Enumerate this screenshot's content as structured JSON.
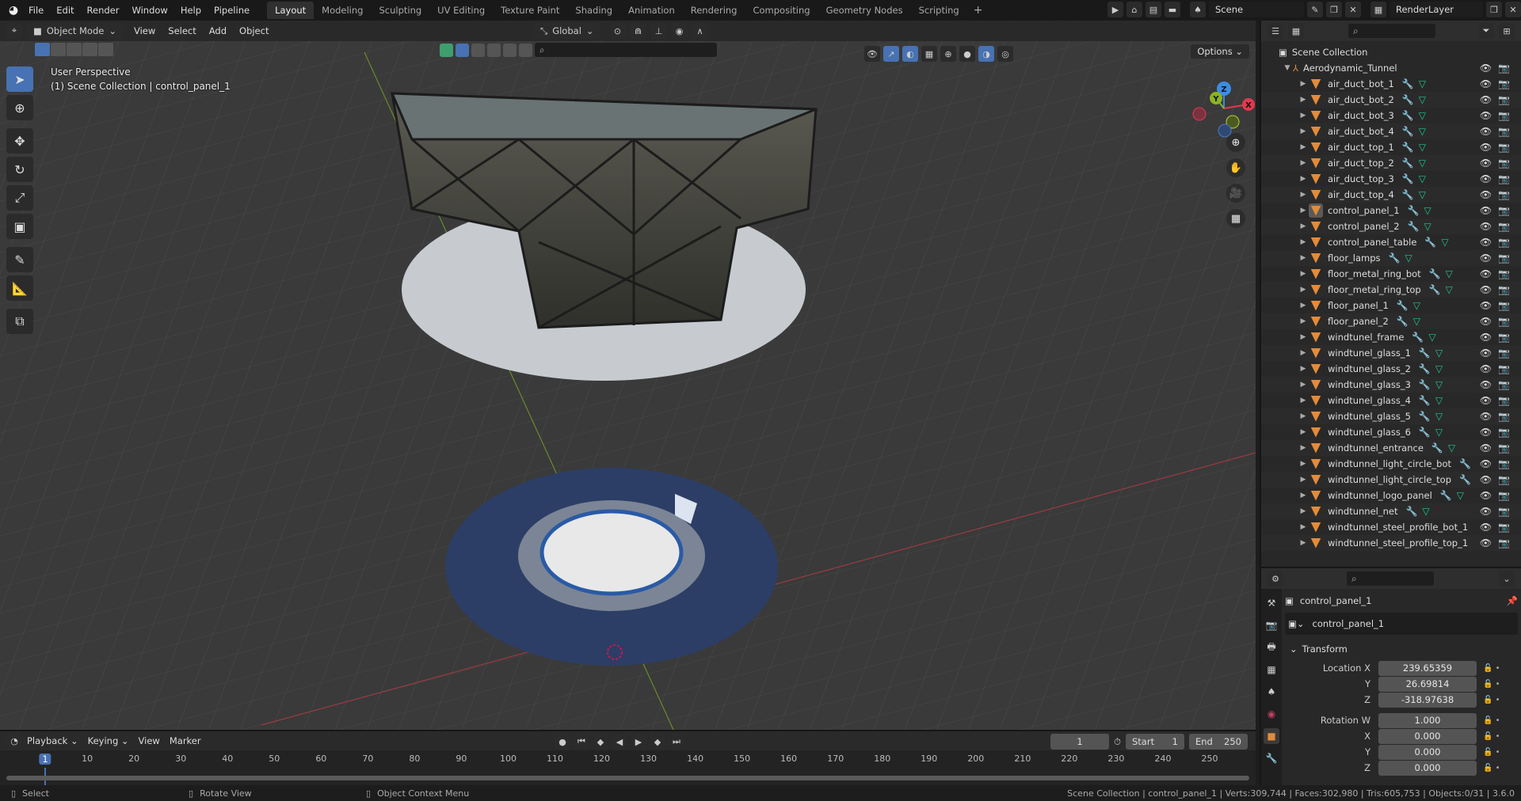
{
  "topbar": {
    "menu": [
      "File",
      "Edit",
      "Render",
      "Window",
      "Help",
      "Pipeline"
    ],
    "workspaces": [
      {
        "label": "Layout",
        "active": true
      },
      {
        "label": "Modeling"
      },
      {
        "label": "Sculpting"
      },
      {
        "label": "UV Editing"
      },
      {
        "label": "Texture Paint"
      },
      {
        "label": "Shading"
      },
      {
        "label": "Animation"
      },
      {
        "label": "Rendering"
      },
      {
        "label": "Compositing"
      },
      {
        "label": "Geometry Nodes"
      },
      {
        "label": "Scripting"
      }
    ],
    "add_workspace": "+",
    "scene": "Scene",
    "view_layer": "RenderLayer"
  },
  "viewport": {
    "mode": "Object Mode",
    "menus": [
      "View",
      "Select",
      "Add",
      "Object"
    ],
    "transform_orientation": "Global",
    "options_label": "Options",
    "overlay_line1": "User Perspective",
    "overlay_line2": "(1) Scene Collection | control_panel_1",
    "gizmo_axes": {
      "x": "X",
      "y": "Y",
      "z": "Z"
    },
    "colors": {
      "x": "#e2394f",
      "y": "#8bb320",
      "z": "#3b8de3",
      "accent": "#4772b3"
    }
  },
  "outliner": {
    "scene_collection": "Scene Collection",
    "collection": "Aerodynamic_Tunnel",
    "objects": [
      {
        "name": "air_duct_bot_1",
        "modifier": true,
        "mesh": true
      },
      {
        "name": "air_duct_bot_2",
        "modifier": true,
        "mesh": true
      },
      {
        "name": "air_duct_bot_3",
        "modifier": true,
        "mesh": true
      },
      {
        "name": "air_duct_bot_4",
        "modifier": true,
        "mesh": true
      },
      {
        "name": "air_duct_top_1",
        "modifier": true,
        "mesh": true
      },
      {
        "name": "air_duct_top_2",
        "modifier": true,
        "mesh": true
      },
      {
        "name": "air_duct_top_3",
        "modifier": true,
        "mesh": true
      },
      {
        "name": "air_duct_top_4",
        "modifier": true,
        "mesh": true
      },
      {
        "name": "control_panel_1",
        "modifier": true,
        "mesh": true,
        "selected": true
      },
      {
        "name": "control_panel_2",
        "modifier": true,
        "mesh": true
      },
      {
        "name": "control_panel_table",
        "modifier": true,
        "mesh": true
      },
      {
        "name": "floor_lamps",
        "modifier": true,
        "mesh": true
      },
      {
        "name": "floor_metal_ring_bot",
        "modifier": true,
        "mesh": true
      },
      {
        "name": "floor_metal_ring_top",
        "modifier": true,
        "mesh": true
      },
      {
        "name": "floor_panel_1",
        "modifier": true,
        "mesh": true
      },
      {
        "name": "floor_panel_2",
        "modifier": true,
        "mesh": true
      },
      {
        "name": "windtunel_frame",
        "modifier": true,
        "mesh": true
      },
      {
        "name": "windtunel_glass_1",
        "modifier": true,
        "mesh": true
      },
      {
        "name": "windtunel_glass_2",
        "modifier": true,
        "mesh": true
      },
      {
        "name": "windtunel_glass_3",
        "modifier": true,
        "mesh": true
      },
      {
        "name": "windtunel_glass_4",
        "modifier": true,
        "mesh": true
      },
      {
        "name": "windtunel_glass_5",
        "modifier": true,
        "mesh": true
      },
      {
        "name": "windtunel_glass_6",
        "modifier": true,
        "mesh": true
      },
      {
        "name": "windtunnel_entrance",
        "modifier": true,
        "mesh": true
      },
      {
        "name": "windtunnel_light_circle_bot",
        "modifier": true,
        "mesh": false
      },
      {
        "name": "windtunnel_light_circle_top",
        "modifier": true,
        "mesh": false
      },
      {
        "name": "windtunnel_logo_panel",
        "modifier": true,
        "mesh": true
      },
      {
        "name": "windtunnel_net",
        "modifier": true,
        "mesh": true
      },
      {
        "name": "windtunnel_steel_profile_bot_1",
        "modifier": false,
        "mesh": false
      },
      {
        "name": "windtunnel_steel_profile_top_1",
        "modifier": false,
        "mesh": false
      }
    ]
  },
  "properties": {
    "object_name": "control_panel_1",
    "data_name": "control_panel_1",
    "panel_title": "Transform",
    "location": {
      "label": "Location X",
      "x": "239.65359",
      "y": "26.69814",
      "z": "-318.97638"
    },
    "rotation": {
      "label": "Rotation W",
      "w": "1.000",
      "x": "0.000",
      "y": "0.000",
      "z": "0.000"
    },
    "axis_labels": {
      "x": "X",
      "y": "Y",
      "z": "Z"
    }
  },
  "timeline": {
    "menus": [
      "Playback",
      "Keying",
      "View",
      "Marker"
    ],
    "current_frame": "1",
    "start_label": "Start",
    "start": "1",
    "end_label": "End",
    "end": "250",
    "ticks": [
      "10",
      "20",
      "30",
      "40",
      "50",
      "60",
      "70",
      "80",
      "90",
      "100",
      "110",
      "120",
      "130",
      "140",
      "150",
      "160",
      "170",
      "180",
      "190",
      "200",
      "210",
      "220",
      "230",
      "240",
      "250"
    ]
  },
  "statusbar": {
    "hints": [
      "Select",
      "Rotate View",
      "Object Context Menu"
    ],
    "info": "Scene Collection | control_panel_1 | Verts:309,744 | Faces:302,980 | Tris:605,753 | Objects:0/31 | 3.6.0"
  }
}
